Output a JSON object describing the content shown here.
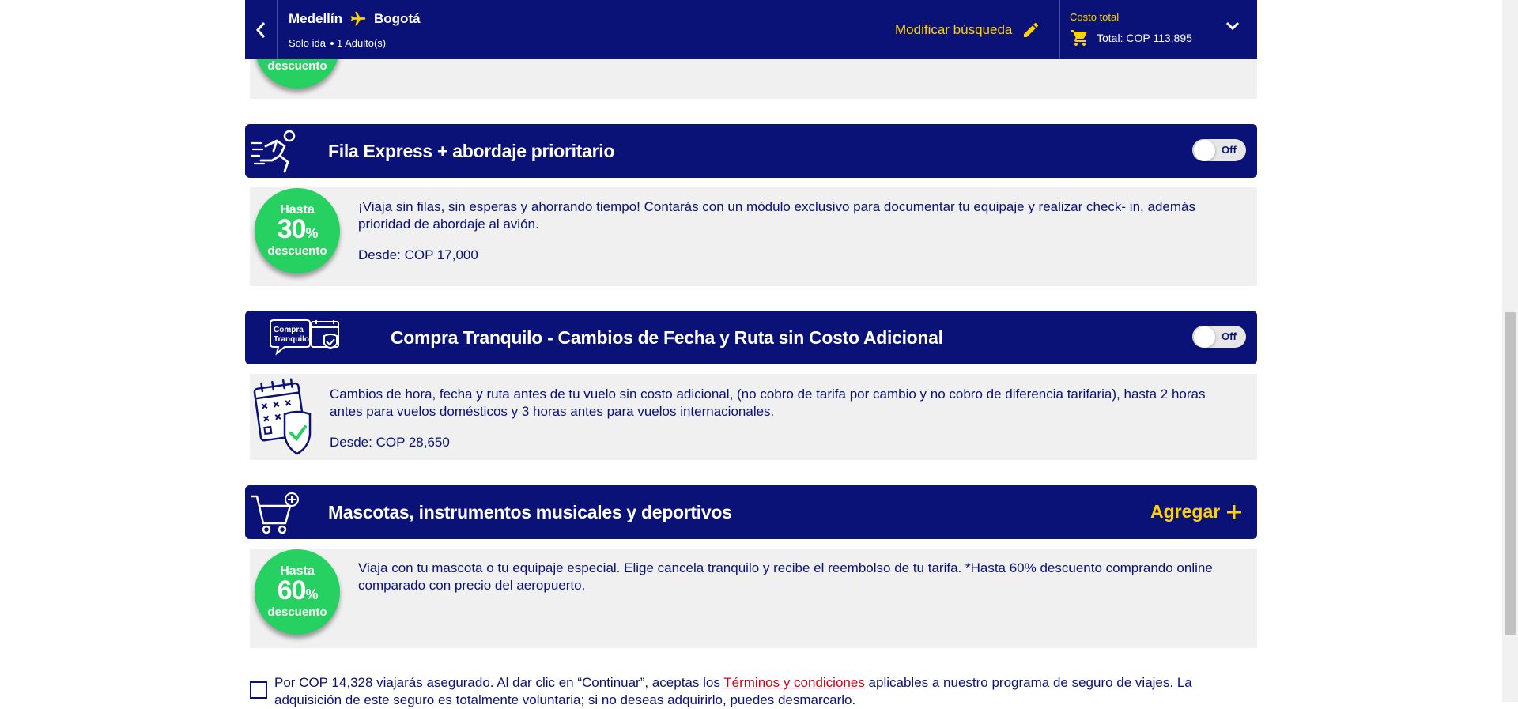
{
  "topbar": {
    "origin": "Medellín",
    "destination": "Bogotá",
    "trip_type": "Solo ida",
    "passengers": "1 Adulto(s)",
    "modify_label": "Modificar búsqueda",
    "cost_label": "Costo total",
    "cost_total": "Total: COP 113,895"
  },
  "top_badge": {
    "line3": "descuento"
  },
  "sections": [
    {
      "title": "Fila Express + abordaje prioritario",
      "toggle_label": "Off",
      "badge": {
        "line1": "Hasta",
        "line2": "30",
        "pct": "%",
        "line3": "descuento"
      },
      "description": "¡Viaja sin filas, sin esperas y ahorrando tiempo! Contarás con un módulo exclusivo para documentar tu equipaje y realizar check- in, además prioridad de abordaje al avión.",
      "price": "Desde: COP 17,000"
    },
    {
      "title": "Compra Tranquilo - Cambios de Fecha y Ruta sin Costo Adicional",
      "icon_text_1": "Compra",
      "icon_text_2": "Tranquilo",
      "toggle_label": "Off",
      "description": "Cambios de hora, fecha y ruta antes de tu vuelo sin costo adicional, (no cobro de tarifa por cambio y no cobro de diferencia tarifaria), hasta 2 horas antes para vuelos domésticos y 3 horas antes para vuelos internacionales.",
      "price": "Desde: COP 28,650"
    },
    {
      "title": "Mascotas, instrumentos musicales y deportivos",
      "action_label": "Agregar",
      "badge": {
        "line1": "Hasta",
        "line2": "60",
        "pct": "%",
        "line3": "descuento"
      },
      "description": "Viaja con tu mascota o tu equipaje especial. Elige cancela tranquilo y recibe el reembolso de tu tarifa. *Hasta 60% descuento comprando online comparado con precio del aeropuerto."
    }
  ],
  "terms": {
    "before": "Por COP 14,328 viajarás asegurado. Al dar clic en “Continuar”, aceptas los ",
    "link": "Términos y condiciones",
    "after": " aplicables a nuestro programa de seguro de viajes. La adquisición de este seguro es totalmente voluntaria; si no deseas adquirirlo, puedes desmarcarlo."
  },
  "colors": {
    "navy": "#0a1278",
    "yellow": "#ffd200",
    "green": "#27d161",
    "link_red": "#d0021b",
    "panel_gray": "#f0f0f0"
  }
}
